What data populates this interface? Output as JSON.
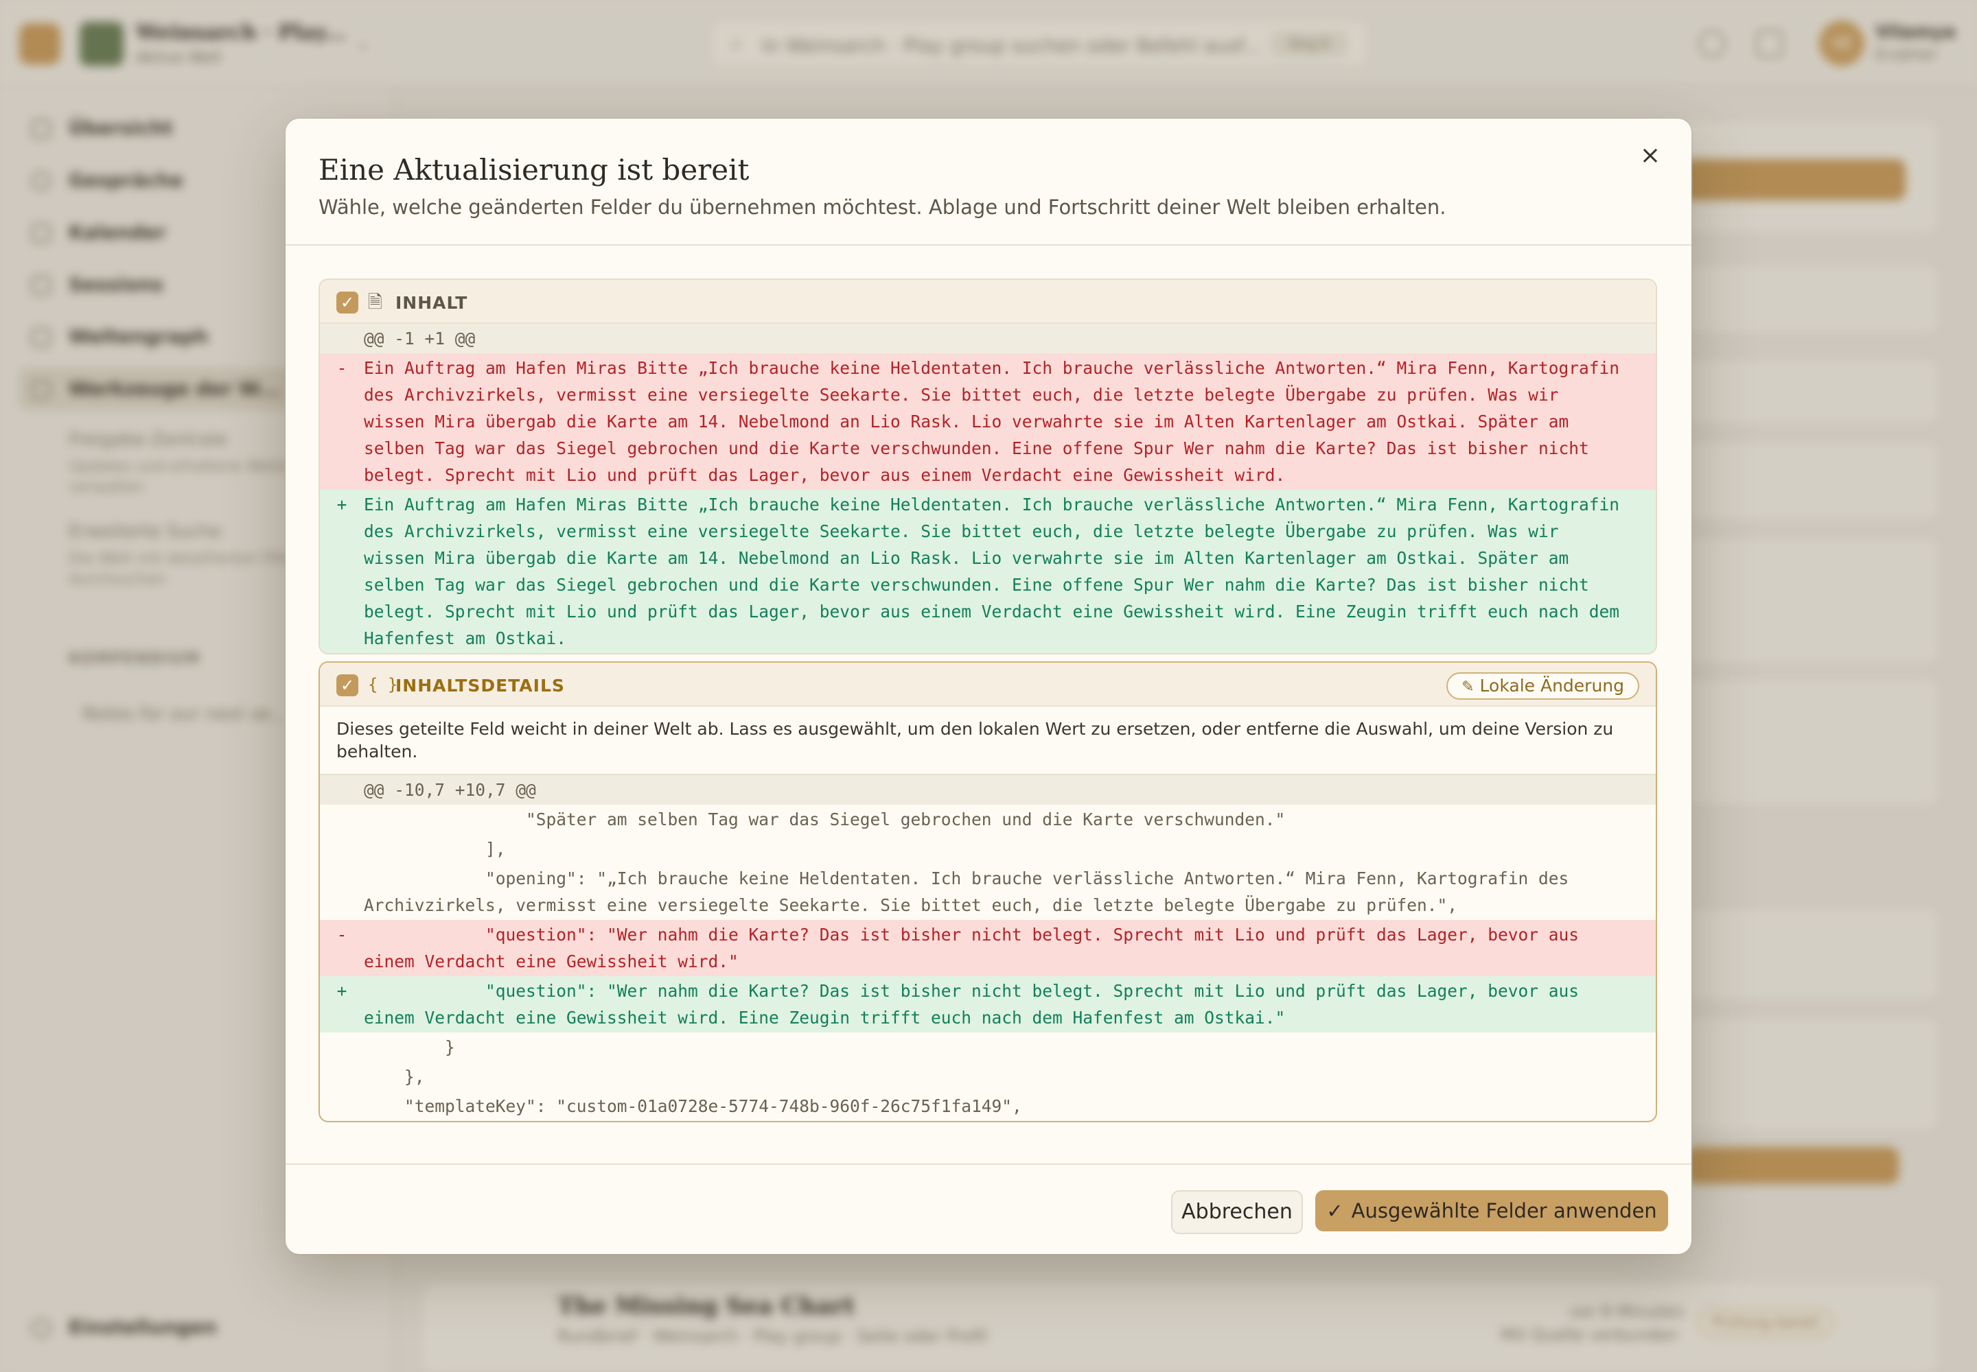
{
  "background": {
    "workspace_name": "Weinsarch · Play...",
    "workspace_sub": "Aktive Welt",
    "search_placeholder": "In Weinsarch · Play group suchen oder Befehl ausf...",
    "search_shortcut": "Strg K",
    "user_initials": "VE",
    "user_name": "Vilamya",
    "user_role": "Erzähler",
    "nav": [
      {
        "label": "Übersicht"
      },
      {
        "label": "Gespräche"
      },
      {
        "label": "Kalender"
      },
      {
        "label": "Sessions"
      },
      {
        "label": "Weltengraph"
      },
      {
        "label": "Werkzeuge der W..."
      }
    ],
    "sub_nav": [
      {
        "label": "Freigabe-Zentrale",
        "desc": "Updates und erhaltene Weltinhalte verwalten"
      },
      {
        "label": "Erweiterte Suche",
        "desc": "Die Welt mit detaillierten Filtern durchsuchen"
      }
    ],
    "section_label": "KOMPENDIUM",
    "section_item": "Notes for our next se...",
    "settings": "Einstellungen",
    "bottom_row_title": "The Missing Sea Chart",
    "bottom_row_sub": "Rundbrief · Weinsarch · Play group · Seite oder Profil",
    "bottom_row_time": "vor 8 Minuten",
    "bottom_row_meta": "Mit Quelle verbunden",
    "bottom_row_badge": "Prüfung bereit"
  },
  "modal": {
    "title": "Eine Aktualisierung ist bereit",
    "subtitle": "Wähle, welche geänderten Felder du übernehmen möchtest. Ablage und Fortschritt deiner Welt bleiben erhalten.",
    "close_label": "×",
    "fields": [
      {
        "label": "INHALT",
        "icon": "document-icon",
        "checked": true,
        "hunk": "@@ -1 +1 @@",
        "removed": "Ein Auftrag am Hafen Miras Bitte „Ich brauche keine Heldentaten. Ich brauche verlässliche Antworten.“ Mira Fenn, Kartografin des Archivzirkels, vermisst eine versiegelte Seekarte. Sie bittet euch, die letzte belegte Übergabe zu prüfen. Was wir wissen Mira übergab die Karte am 14. Nebelmond an Lio Rask. Lio verwahrte sie im Alten Kartenlager am Ostkai. Später am selben Tag war das Siegel gebrochen und die Karte verschwunden. Eine offene Spur Wer nahm die Karte? Das ist bisher nicht belegt. Sprecht mit Lio und prüft das Lager, bevor aus einem Verdacht eine Gewissheit wird.",
        "added": "Ein Auftrag am Hafen Miras Bitte „Ich brauche keine Heldentaten. Ich brauche verlässliche Antworten.“ Mira Fenn, Kartografin des Archivzirkels, vermisst eine versiegelte Seekarte. Sie bittet euch, die letzte belegte Übergabe zu prüfen. Was wir wissen Mira übergab die Karte am 14. Nebelmond an Lio Rask. Lio verwahrte sie im Alten Kartenlager am Ostkai. Später am selben Tag war das Siegel gebrochen und die Karte verschwunden. Eine offene Spur Wer nahm die Karte? Das ist bisher nicht belegt. Sprecht mit Lio und prüft das Lager, bevor aus einem Verdacht eine Gewissheit wird. Eine Zeugin trifft euch nach dem Hafenfest am Ostkai."
      },
      {
        "label": "INHALTSDETAILS",
        "icon": "braces-icon",
        "checked": true,
        "badge": "Lokale Änderung",
        "note": "Dieses geteilte Feld weicht in deiner Welt ab. Lass es ausgewählt, um den lokalen Wert zu ersetzen, oder entferne die Auswahl, um deine Version zu behalten.",
        "hunk": "@@ -10,7 +10,7 @@",
        "ctx_before": [
          "                \"Später am selben Tag war das Siegel gebrochen und die Karte verschwunden.\"",
          "            ],",
          "            \"opening\": \"„Ich brauche keine Heldentaten. Ich brauche verlässliche Antworten.“ Mira Fenn, Kartografin des Archivzirkels, vermisst eine versiegelte Seekarte. Sie bittet euch, die letzte belegte Übergabe zu prüfen.\","
        ],
        "removed": "            \"question\": \"Wer nahm die Karte? Das ist bisher nicht belegt. Sprecht mit Lio und prüft das Lager, bevor aus einem Verdacht eine Gewissheit wird.\"",
        "added": "            \"question\": \"Wer nahm die Karte? Das ist bisher nicht belegt. Sprecht mit Lio und prüft das Lager, bevor aus einem Verdacht eine Gewissheit wird. Eine Zeugin trifft euch nach dem Hafenfest am Ostkai.\"",
        "ctx_after": [
          "        }",
          "    },",
          "    \"templateKey\": \"custom-01a0728e-5774-748b-960f-26c75f1fa149\","
        ]
      }
    ],
    "diff_signs": {
      "removed": "-",
      "added": "+",
      "context": " "
    },
    "cancel_label": "Abbrechen",
    "apply_label": "Ausgewählte Felder anwenden"
  }
}
